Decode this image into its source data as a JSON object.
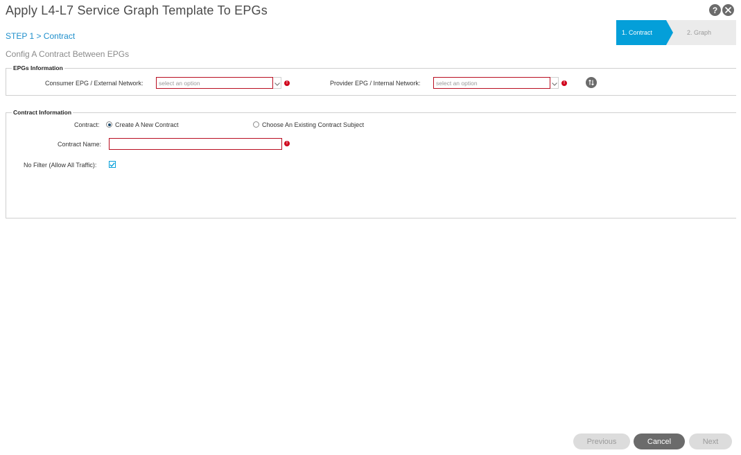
{
  "header": {
    "title": "Apply L4-L7 Service Graph Template To EPGs",
    "help_icon": "help-icon",
    "close_icon": "close-icon"
  },
  "step": {
    "label": "STEP 1 > Contract"
  },
  "subtitle": "Config A Contract Between EPGs",
  "wizard": {
    "steps": [
      {
        "label": "1. Contract",
        "active": true
      },
      {
        "label": "2. Graph",
        "active": false
      }
    ],
    "active_color": "#049fd9"
  },
  "epgs": {
    "legend": "EPGs Information",
    "consumer_label": "Consumer EPG / External Network:",
    "consumer_placeholder": "select an option",
    "provider_label": "Provider EPG / Internal Network:",
    "provider_placeholder": "select an option",
    "swap_icon": "swap-icon"
  },
  "contract": {
    "legend": "Contract Information",
    "contract_label": "Contract:",
    "options": [
      {
        "label": "Create A New Contract",
        "selected": true
      },
      {
        "label": "Choose An Existing Contract Subject",
        "selected": false
      }
    ],
    "name_label": "Contract Name:",
    "name_value": "",
    "no_filter_label": "No Filter (Allow All Traffic):",
    "no_filter_checked": true
  },
  "footer": {
    "previous": "Previous",
    "cancel": "Cancel",
    "next": "Next"
  },
  "colors": {
    "error": "#d0021b",
    "invalid_border": "#b80c1f",
    "link": "#1d8ecb"
  }
}
